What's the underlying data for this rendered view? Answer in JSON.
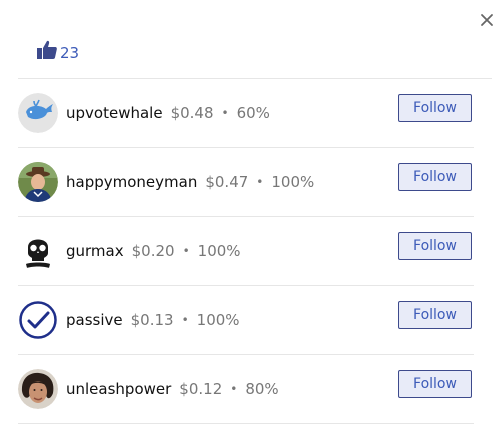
{
  "dialog": {
    "close_icon": "close-icon",
    "vote_icon": "thumbs-up-icon",
    "vote_count": "23",
    "accent_color": "#3d5bb8"
  },
  "voters": [
    {
      "name": "upvotewhale",
      "amount": "$0.48",
      "separator": "•",
      "percent": "60%",
      "button": "Follow",
      "avatar": "whale-avatar"
    },
    {
      "name": "happymoneyman",
      "amount": "$0.47",
      "separator": "•",
      "percent": "100%",
      "button": "Follow",
      "avatar": "cowboy-man-avatar"
    },
    {
      "name": "gurmax",
      "amount": "$0.20",
      "separator": "•",
      "percent": "100%",
      "button": "Follow",
      "avatar": "skull-avatar"
    },
    {
      "name": "passive",
      "amount": "$0.13",
      "separator": "•",
      "percent": "100%",
      "button": "Follow",
      "avatar": "checkmark-avatar"
    },
    {
      "name": "unleashpower",
      "amount": "$0.12",
      "separator": "•",
      "percent": "80%",
      "button": "Follow",
      "avatar": "woman-avatar"
    }
  ]
}
